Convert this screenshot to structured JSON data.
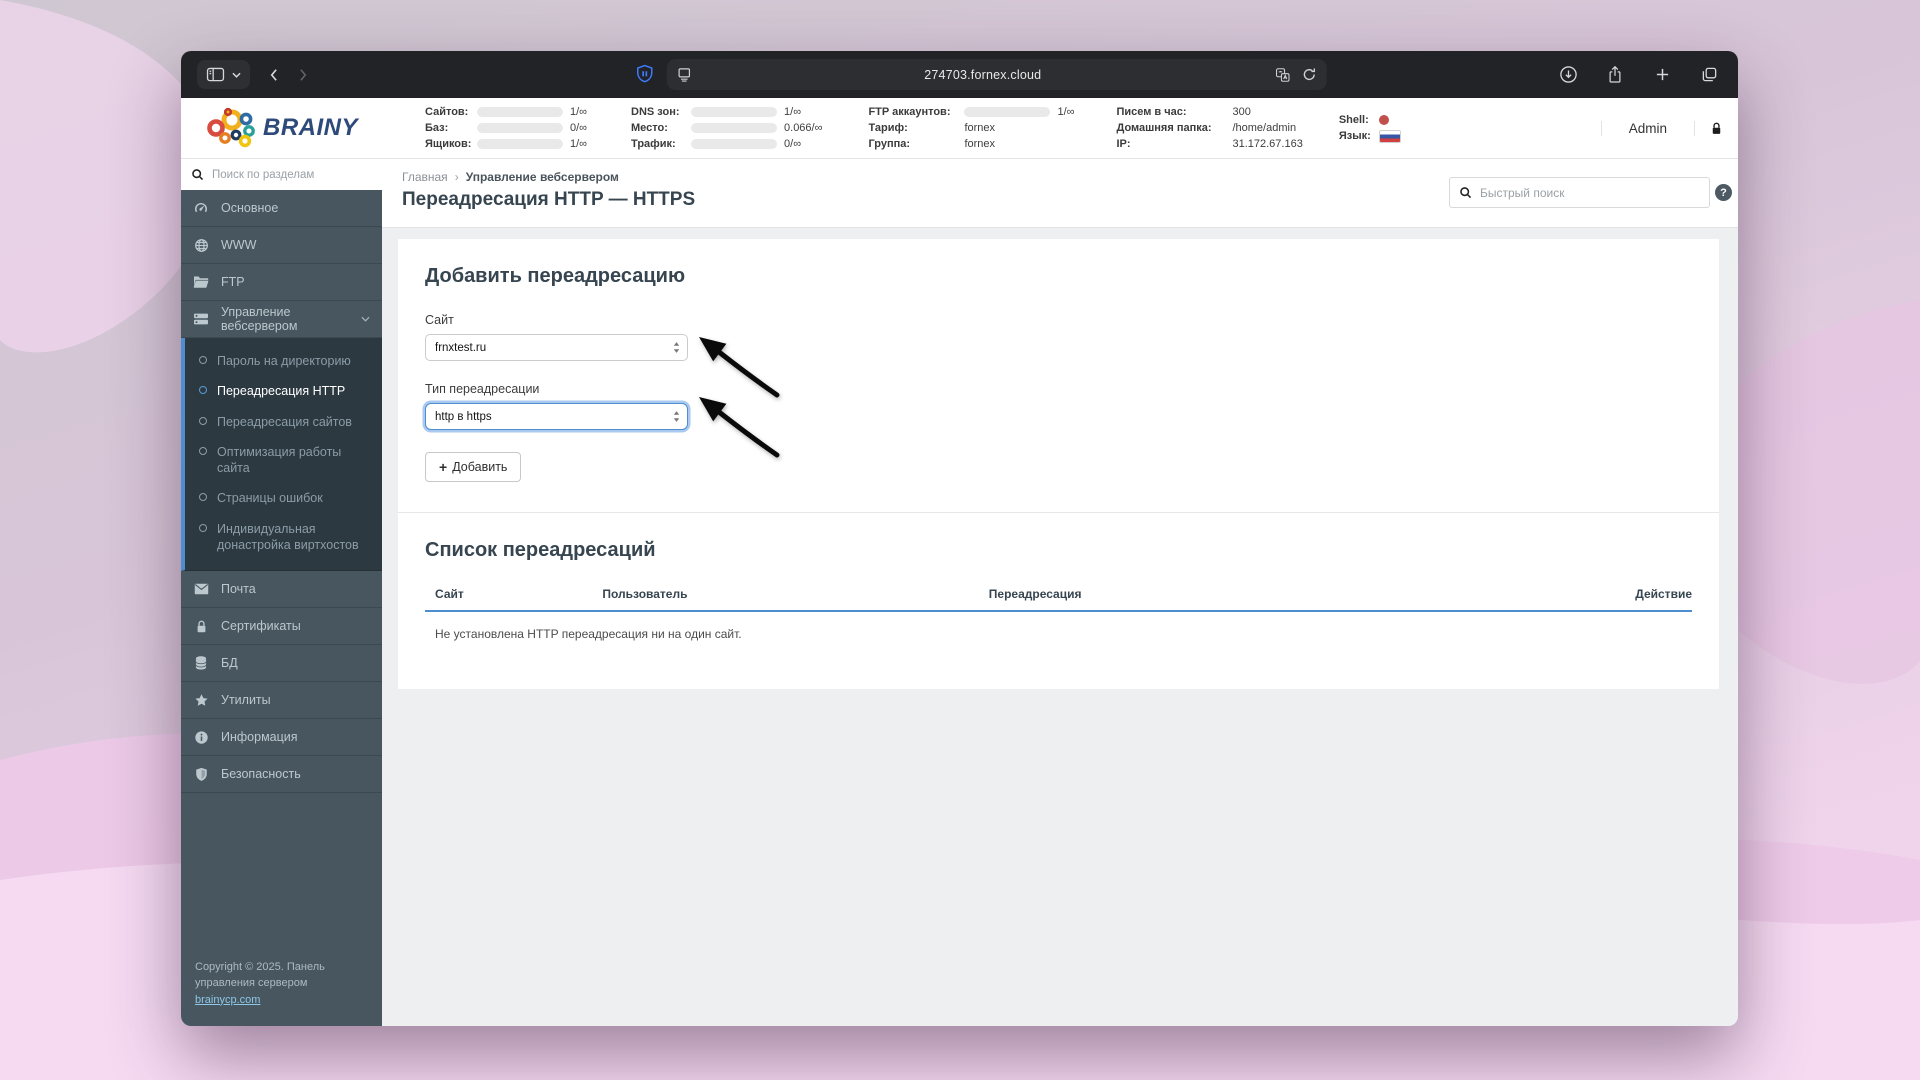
{
  "browser": {
    "url": "274703.fornex.cloud"
  },
  "panel_header": {
    "logo_text": "BRAINY",
    "user_label": "Admin",
    "stats": {
      "col1": [
        {
          "label": "Сайтов:",
          "value": "1/∞"
        },
        {
          "label": "Баз:",
          "value": "0/∞"
        },
        {
          "label": "Ящиков:",
          "value": "1/∞"
        }
      ],
      "col2": [
        {
          "label": "DNS зон:",
          "value": "1/∞"
        },
        {
          "label": "Место:",
          "value": "0.066/∞"
        },
        {
          "label": "Трафик:",
          "value": "0/∞"
        }
      ],
      "col3": [
        {
          "label": "FTP аккаунтов:",
          "value": "1/∞"
        },
        {
          "label": "Тариф:",
          "value": "fornex"
        },
        {
          "label": "Группа:",
          "value": "fornex"
        }
      ],
      "col4": [
        {
          "label": "Писем в час:",
          "value": "300"
        },
        {
          "label": "Домашняя папка:",
          "value": "/home/admin"
        },
        {
          "label": "IP:",
          "value": "31.172.67.163"
        }
      ],
      "col5": [
        {
          "label": "Shell:"
        },
        {
          "label": "Язык:"
        }
      ]
    }
  },
  "sidebar": {
    "search_placeholder": "Поиск по разделам",
    "items_top": [
      {
        "label": "Основное"
      },
      {
        "label": "WWW"
      },
      {
        "label": "FTP"
      },
      {
        "label": "Управление вебсервером"
      }
    ],
    "submenu": [
      {
        "label": "Пароль на директорию"
      },
      {
        "label": "Переадресация HTTP"
      },
      {
        "label": "Переадресация сайтов"
      },
      {
        "label": "Оптимизация работы сайта"
      },
      {
        "label": "Страницы ошибок"
      },
      {
        "label": "Индивидуальная донастройка виртхостов"
      }
    ],
    "items_bottom": [
      {
        "label": "Почта"
      },
      {
        "label": "Сертификаты"
      },
      {
        "label": "БД"
      },
      {
        "label": "Утилиты"
      },
      {
        "label": "Информация"
      },
      {
        "label": "Безопасность"
      }
    ],
    "footer_text": "Copyright © 2025. Панель управления сервером",
    "footer_link": "brainycp.com"
  },
  "page": {
    "breadcrumb": [
      "Главная",
      "Управление вебсервером"
    ],
    "breadcrumb_separator": "›",
    "title": "Переадресация HTTP — HTTPS",
    "quick_search_placeholder": "Быстрый поиск",
    "help_label": "?"
  },
  "form": {
    "heading": "Добавить переадресацию",
    "site_label": "Сайт",
    "site_value": "frnxtest.ru",
    "type_label": "Тип переадресации",
    "type_value": "http в https",
    "plus_sign": "+",
    "submit_label": "Добавить"
  },
  "redirect_list": {
    "heading": "Список переадресаций",
    "columns": [
      "Сайт",
      "Пользователь",
      "Переадресация",
      "Действие"
    ],
    "empty_message": "Не установлена HTTP переадресация ни на один сайт."
  },
  "colors": {
    "accent_blue": "#4d8dd0",
    "sidebar_bg": "#47565f",
    "submenu_bg": "#2c3941",
    "title_color": "#36454f",
    "shell_status_red": "#c0504d"
  }
}
